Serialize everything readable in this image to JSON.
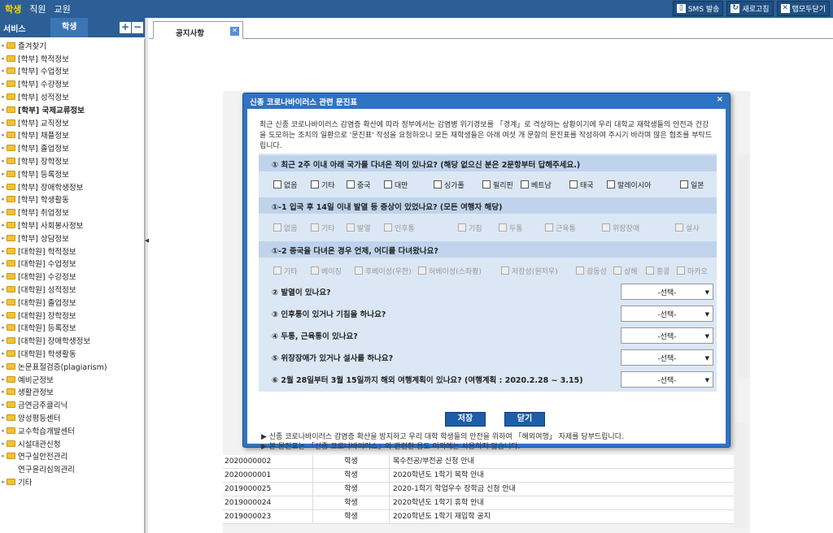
{
  "topnav": {
    "items": [
      "학생",
      "직원",
      "교원"
    ]
  },
  "topbuttons": [
    {
      "label": "SMS 발송",
      "icon": "phone-icon"
    },
    {
      "label": "새로고침",
      "icon": "refresh-icon"
    },
    {
      "label": "탭모두닫기",
      "icon": "close-icon"
    }
  ],
  "sidebar": {
    "header_left": "서비스",
    "header_tab": "학생",
    "items": [
      "즐겨찾기",
      "[학부] 학적정보",
      "[학부] 수업정보",
      "[학부] 수강정보",
      "[학부] 성적정보",
      "[학부] 국제교류정보",
      "[학부] 교직정보",
      "[학부] 채플정보",
      "[학부] 졸업정보",
      "[학부] 장학정보",
      "[학부] 등록정보",
      "[학부] 장애학생정보",
      "[학부] 학생활동",
      "[학부] 취업정보",
      "[학부] 사회봉사정보",
      "[학부] 상담정보",
      "[대학원] 학적정보",
      "[대학원] 수업정보",
      "[대학원] 수강정보",
      "[대학원] 성적정보",
      "[대학원] 졸업정보",
      "[대학원] 장학정보",
      "[대학원] 등록정보",
      "[대학원] 장애학생정보",
      "[대학원] 학생활동",
      "논문표절검증(plagiarism)",
      "예비군정보",
      "생활관정보",
      "금연금주클리닉",
      "양성평등센터",
      "교수학습개발센터",
      "시설대관신청",
      "연구실안전관리",
      "연구윤리심의관리",
      "기타"
    ]
  },
  "tab": {
    "label": "공지사항"
  },
  "modal": {
    "title": "신종 코로나바이러스 관련 문진표",
    "close": "×",
    "intro": "최근 신종 코로나바이러스 감염증 확산에 따라 정부에서는 감염병 위기경보를 「경계」로 격상하는 상황이기에 우리 대학교 재학생들의 안전과 건강을 도모하는 조치의 일환으로 '문진표' 작성을 요청하오니 모든 재학생들은 아래 여섯 개 문항의 문진표를 작성하여 주시기 바라며 많은 협조를 부탁드립니다.",
    "q1": "① 최근 2주 이내 아래 국가를 다녀온 적이 있나요? (해당 없으신 분은 2문항부터 답해주세요.)",
    "q1_options": [
      "없음",
      "기타",
      "중국",
      "대만",
      "싱가폴",
      "필리핀",
      "베트남",
      "태국",
      "말레이시아",
      "일본"
    ],
    "q1_1": "①-1 입국 후 14일 이내 발열 등 증상이 있었나요? (모든 여행자 해당)",
    "q1_1_options": [
      "없음",
      "기타",
      "발열",
      "인후통",
      "기침",
      "두통",
      "근육통",
      "위장장애",
      "설사"
    ],
    "q1_2": "①-2 중국을 다녀온 경우 언제, 어디를 다녀왔나요?",
    "q1_2_options": [
      "기타",
      "베이징",
      "후베이성(우한)",
      "허베이성(스좌퐝)",
      "저장성(원저우)",
      "광동성",
      "상해",
      "홍콩",
      "마카오"
    ],
    "q2": "② 발열이 있나요?",
    "q3": "③ 인후통이 있거나 기침을 하나요?",
    "q4": "④ 두통, 근육통이 있나요?",
    "q5": "⑤ 위장장애가 있거나 설사를 하나요?",
    "q6": "⑥ 2월 28일부터 3월 15일까지 해외 여행계획이 있나요? (여행계획 : 2020.2.28 ~ 3.15)",
    "select_placeholder": "-선택-",
    "save": "저장",
    "close_btn": "닫기",
    "note1": "▶ 신종 코로나바이러스 감염증 확산을 방지하고 우리 대학 학생들의 안전을 위하여 「해외여행」 자제를 당부드립니다.",
    "note2": "▶ 본 문진표는 「신종 코로나바이러스」와 관련한 용도 이외에는 사용하지 않습니다."
  },
  "background_table": {
    "rows": [
      [
        "2020000002",
        "학생",
        "복수전공/부전공 신청 안내"
      ],
      [
        "2020000001",
        "학생",
        "2020학년도 1학기 복학 안내"
      ],
      [
        "2019000025",
        "학생",
        "2020-1학기 학업우수 장학금 신청 안내"
      ],
      [
        "2019000024",
        "학생",
        "2020학년도 1학기 휴학 안내"
      ],
      [
        "2019000023",
        "학생",
        "2020학년도 1학기 재입학 공지"
      ]
    ]
  }
}
